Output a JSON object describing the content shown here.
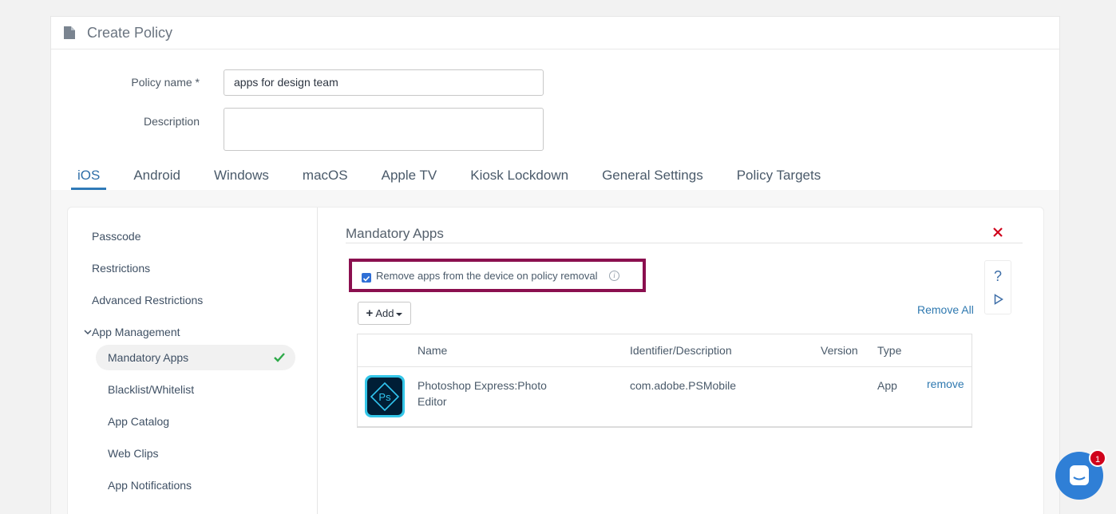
{
  "header": {
    "title": "Create Policy",
    "icon": "document-icon"
  },
  "form": {
    "policy_name_label": "Policy name *",
    "policy_name_value": "apps for design team",
    "description_label": "Description",
    "description_value": ""
  },
  "tabs": [
    {
      "label": "iOS",
      "active": true
    },
    {
      "label": "Android"
    },
    {
      "label": "Windows"
    },
    {
      "label": "macOS"
    },
    {
      "label": "Apple TV"
    },
    {
      "label": "Kiosk Lockdown"
    },
    {
      "label": "General Settings"
    },
    {
      "label": "Policy Targets"
    }
  ],
  "sidebar": {
    "items": [
      {
        "label": "Passcode"
      },
      {
        "label": "Restrictions"
      },
      {
        "label": "Advanced Restrictions"
      },
      {
        "label": "App Management",
        "expanded": true
      }
    ],
    "sub_items": [
      {
        "label": "Mandatory Apps",
        "active": true,
        "complete": true
      },
      {
        "label": "Blacklist/Whitelist"
      },
      {
        "label": "App Catalog"
      },
      {
        "label": "Web Clips"
      },
      {
        "label": "App Notifications"
      }
    ]
  },
  "main": {
    "section_title": "Mandatory Apps",
    "remove_apps_checkbox_label": "Remove apps from the device on policy removal",
    "remove_apps_checked": true,
    "info_glyph": "i",
    "add_button_label": "Add",
    "remove_all_label": "Remove All",
    "help_glyph": "?",
    "table": {
      "headers": [
        "Name",
        "Identifier/Description",
        "Version",
        "Type"
      ],
      "rows": [
        {
          "icon_label": "Ps",
          "name": "Photoshop Express:Photo Editor",
          "identifier": "com.adobe.PSMobile",
          "version": "",
          "type": "App",
          "action": "remove"
        }
      ]
    }
  },
  "chat": {
    "badge_count": "1"
  },
  "colors": {
    "accent": "#2f79b0",
    "highlight_border": "#8b0f4f",
    "close_red": "#d0021b",
    "success_green": "#2eaa4a",
    "chat_blue": "#2f7fd6"
  }
}
